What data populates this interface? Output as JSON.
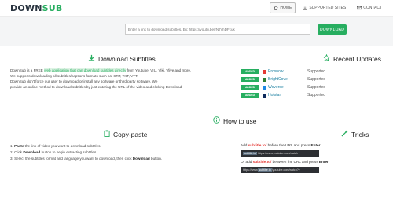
{
  "header": {
    "logo_a": "DOWN",
    "logo_b": "SUB",
    "nav": [
      {
        "label": "HOME",
        "icon": "home-icon"
      },
      {
        "label": "SUPPORTED SITES",
        "icon": "list-icon"
      },
      {
        "label": "CONTACT",
        "icon": "envelope-icon"
      }
    ]
  },
  "search": {
    "placeholder": "Enter a link to download subtitles. Ex: https://youtu.be/rN7yhDFcuk",
    "button_label": "DOWNLOAD"
  },
  "download_section": {
    "title": "Download Subtitles",
    "intro_1a": "DownSub is a FREE ",
    "intro_1b": "web application that can download subtitles directly",
    "intro_1c": " from Youtube, VIU, Viki, Vlive and more.",
    "intro_2": "We supports downloading all subtitles/captions formats such as: SRT, TXT, VTT.",
    "intro_3": "DownSub don't force our user to download or install any software or third party software. We",
    "intro_4": "provide an online method to download subtitles by just entering the URL of the video and clicking Download."
  },
  "updates": {
    "title": "Recent Updates",
    "items": [
      {
        "badge": "ADDED",
        "site": "Erosnow",
        "status": "Supported",
        "color": "#e53935"
      },
      {
        "badge": "ADDED",
        "site": "BrightCove",
        "status": "Supported",
        "color": "#2e7d32"
      },
      {
        "badge": "ADDED",
        "site": "Weverse",
        "status": "Supported",
        "color": "#1e88e5"
      },
      {
        "badge": "ADDED",
        "site": "Hotstar",
        "status": "Supported",
        "color": "#0d2a5c"
      }
    ]
  },
  "howto": {
    "title": "How to use",
    "copy_title": "Copy-paste",
    "tricks_title": "Tricks",
    "step1_num": "1.",
    "step1_b": "Paste",
    "step1_rest": " the link of video you want to download subtitles.",
    "step2_num": "2. Click",
    "step2_b": "Download",
    "step2_rest": " button to begin extracting subtitles.",
    "step3_pre": "3. Select the subtitles format and language you want to download, then click",
    "step3_b": "Download",
    "step3_post": " button.",
    "trick1_pre": "Add ",
    "trick1_red": "subtitle.to/",
    "trick1_post": " before the URL and press ",
    "trick1_enter": "Enter",
    "trick1_bar_a": "subtitle.to/",
    "trick1_bar_b": "https://www.youtube.com/watch",
    "trick2_pre": "Or add ",
    "trick2_red": "subtitle.to/",
    "trick2_post": " between the URL and press ",
    "trick2_enter": "Enter",
    "trick2_bar_a": "https://www.",
    "trick2_bar_b": "subtitle.to",
    "trick2_bar_c": "/youtube.com/watch?v"
  },
  "colors": {
    "accent": "#27ae60",
    "red": "#e53935"
  }
}
